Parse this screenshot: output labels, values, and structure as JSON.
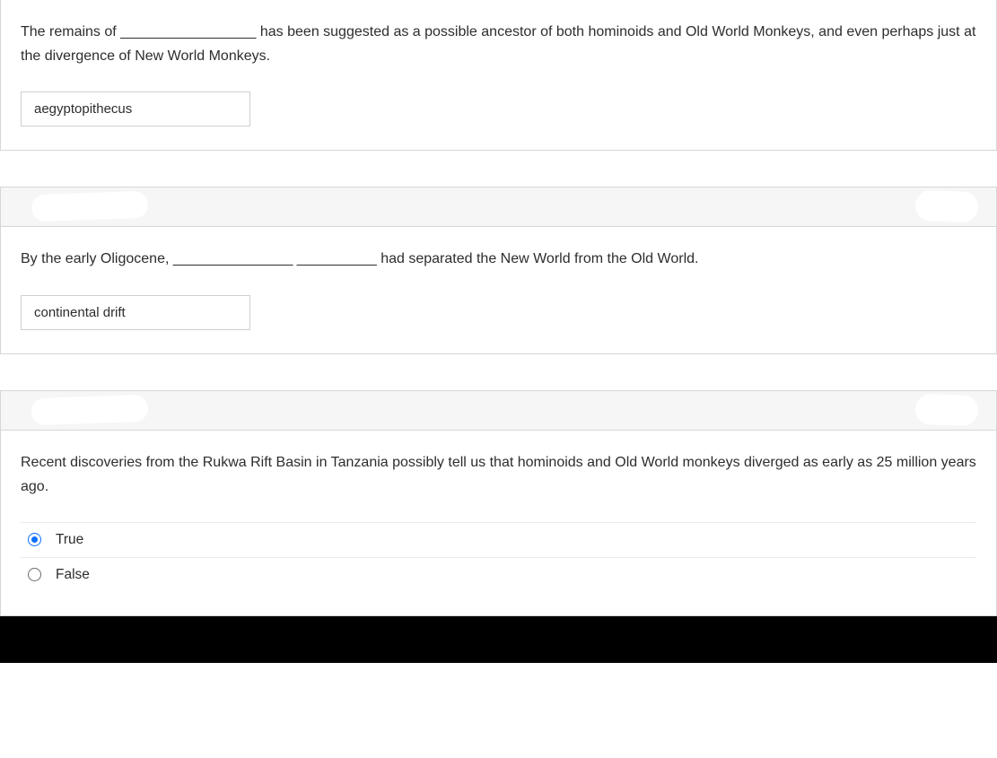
{
  "q1": {
    "prompt": "The remains of _________________ has been suggested as a possible ancestor of both hominoids and Old World Monkeys, and even perhaps just at the divergence of New World Monkeys.",
    "answer_value": "aegyptopithecus"
  },
  "q2": {
    "prompt": "By the early Oligocene, _______________ __________ had separated the New World from the Old World.",
    "answer_value": "continental drift"
  },
  "q3": {
    "prompt": "Recent discoveries from the Rukwa Rift Basin in Tanzania possibly tell us that hominoids and Old World monkeys diverged as early as 25 million years ago.",
    "choices": {
      "true_label": "True",
      "false_label": "False"
    },
    "selected": "true"
  }
}
